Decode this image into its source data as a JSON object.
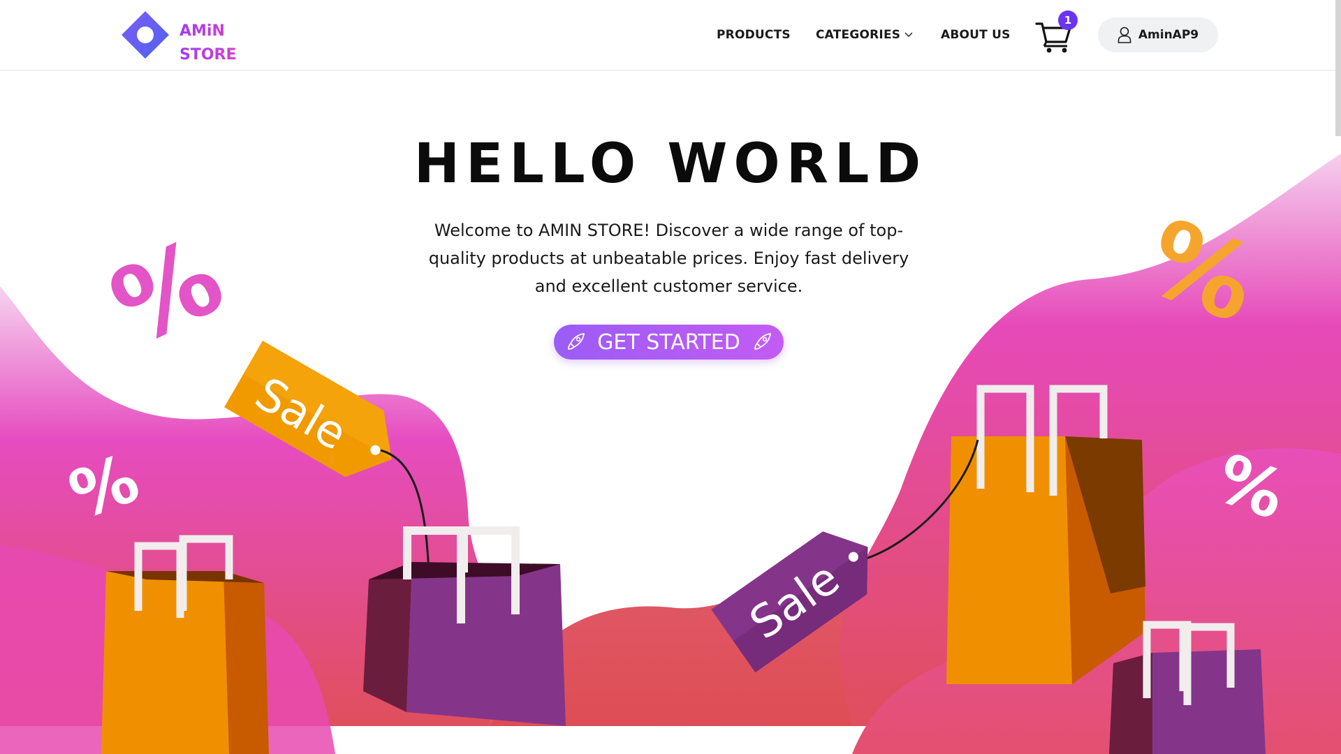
{
  "header": {
    "logo_line1": "AMiN",
    "logo_line2": "STORE",
    "nav": {
      "products": "PRODUCTS",
      "categories": "CATEGORIES",
      "about": "ABOUT US"
    },
    "cart_count": "1",
    "username": "AminAP9"
  },
  "hero": {
    "title": "HELLO WORLD",
    "text": "Welcome to AMIN STORE! Discover a wide range of top-quality products at unbeatable prices. Enjoy fast delivery and excellent customer service.",
    "cta": "GET STARTED",
    "tags": [
      "Sale",
      "Sale"
    ],
    "symbols": [
      "%",
      "%",
      "%",
      "%"
    ]
  },
  "colors": {
    "accent": "#6a35f0",
    "brand_gradient_start": "#a23cf5",
    "brand_gradient_end": "#d43fcf",
    "wave_pink": "#e647b8",
    "wave_red": "#e04f5a",
    "bag_orange": "#f09000",
    "bag_purple": "#83348a"
  },
  "icons": [
    "logo-diamond-icon",
    "chevron-down-icon",
    "cart-icon",
    "user-icon",
    "rocket-icon"
  ]
}
